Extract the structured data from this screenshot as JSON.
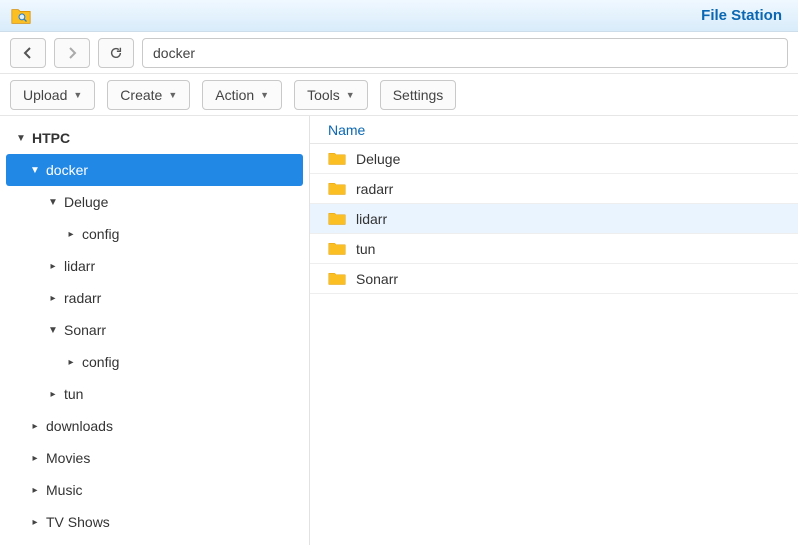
{
  "header": {
    "app_title": "File Station"
  },
  "nav": {
    "path_value": "docker"
  },
  "toolbar": {
    "upload": "Upload",
    "create": "Create",
    "action": "Action",
    "tools": "Tools",
    "settings": "Settings"
  },
  "tree": {
    "root": "HTPC",
    "items": [
      {
        "label": "docker",
        "depth": 1,
        "expanded": true,
        "selected": true
      },
      {
        "label": "Deluge",
        "depth": 2,
        "expanded": true,
        "selected": false
      },
      {
        "label": "config",
        "depth": 3,
        "expanded": false,
        "selected": false
      },
      {
        "label": "lidarr",
        "depth": 2,
        "expanded": false,
        "selected": false
      },
      {
        "label": "radarr",
        "depth": 2,
        "expanded": false,
        "selected": false
      },
      {
        "label": "Sonarr",
        "depth": 2,
        "expanded": true,
        "selected": false
      },
      {
        "label": "config",
        "depth": 3,
        "expanded": false,
        "selected": false
      },
      {
        "label": "tun",
        "depth": 2,
        "expanded": false,
        "selected": false
      },
      {
        "label": "downloads",
        "depth": 1,
        "expanded": false,
        "selected": false
      },
      {
        "label": "Movies",
        "depth": 1,
        "expanded": false,
        "selected": false
      },
      {
        "label": "Music",
        "depth": 1,
        "expanded": false,
        "selected": false
      },
      {
        "label": "TV Shows",
        "depth": 1,
        "expanded": false,
        "selected": false
      }
    ]
  },
  "list": {
    "column_name": "Name",
    "rows": [
      {
        "name": "Deluge",
        "highlighted": false
      },
      {
        "name": "radarr",
        "highlighted": false
      },
      {
        "name": "lidarr",
        "highlighted": true
      },
      {
        "name": "tun",
        "highlighted": false
      },
      {
        "name": "Sonarr",
        "highlighted": false
      }
    ]
  }
}
